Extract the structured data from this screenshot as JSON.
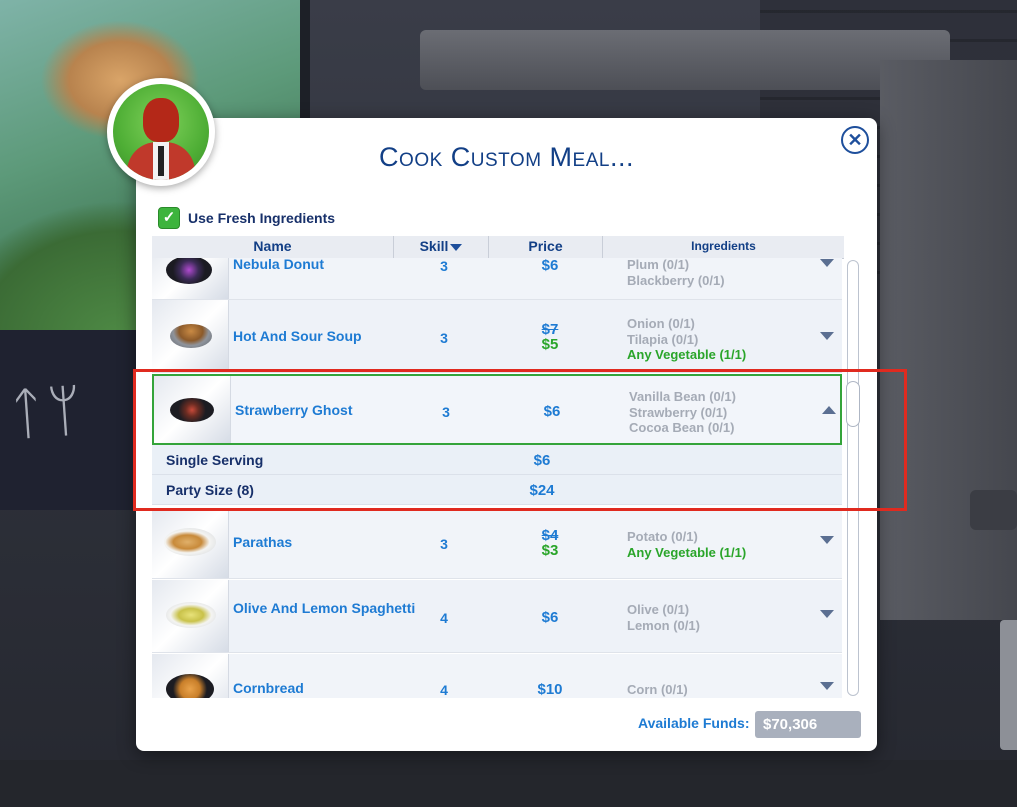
{
  "background": {
    "sign_text": "ᛏᛘ"
  },
  "dialog": {
    "title": "Cook Custom Meal...",
    "close_icon": "close-icon",
    "use_fresh_label": "Use Fresh Ingredients",
    "use_fresh_checked": true,
    "columns": {
      "name": "Name",
      "skill": "Skill",
      "price": "Price",
      "ingredients": "Ingredients"
    },
    "recipes": [
      {
        "name": "Nebula Donut",
        "skill": "3",
        "price": "$6",
        "ingredients": [
          "Plum (0/1)",
          "Blackberry (0/1)"
        ]
      },
      {
        "name": "Hot And Sour Soup",
        "skill": "3",
        "old_price": "$7",
        "price": "$5",
        "ingredients": [
          "Onion (0/1)",
          "Tilapia (0/1)",
          "Any Vegetable (1/1)"
        ]
      },
      {
        "name": "Strawberry Ghost",
        "skill": "3",
        "price": "$6",
        "ingredients": [
          "Vanilla Bean (0/1)",
          "Strawberry (0/1)",
          "Cocoa Bean (0/1)"
        ],
        "expanded": true
      },
      {
        "name": "Parathas",
        "skill": "3",
        "old_price": "$4",
        "price": "$3",
        "ingredients": [
          "Potato (0/1)",
          "Any Vegetable (1/1)"
        ]
      },
      {
        "name": "Olive And Lemon Spaghetti",
        "skill": "4",
        "price": "$6",
        "ingredients": [
          "Olive (0/1)",
          "Lemon (0/1)"
        ]
      },
      {
        "name": "Cornbread",
        "skill": "4",
        "price": "$10",
        "ingredients": [
          "Corn (0/1)"
        ]
      }
    ],
    "serving_options": [
      {
        "label": "Single Serving",
        "price": "$6"
      },
      {
        "label": "Party Size (8)",
        "price": "$24"
      }
    ],
    "funds_label": "Available Funds:",
    "funds_value": "$70,306"
  },
  "colors": {
    "accent": "#1e7bd3",
    "title": "#123f86",
    "ok_green": "#2aa52a",
    "highlight": "#e02a1f"
  }
}
